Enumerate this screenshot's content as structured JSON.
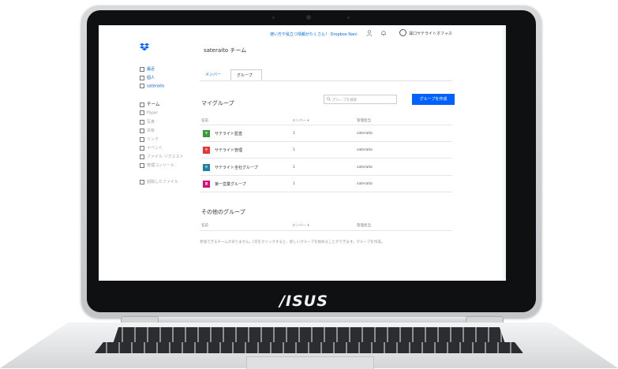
{
  "device": {
    "brand": "/ISUS"
  },
  "app": {
    "page_title": "sateraito チーム",
    "topbar_link": "使い方や役立つ情報がたくさん！ Dropbox Nani",
    "user_name": "凜口サテライトオフィス",
    "caret": "⌄"
  },
  "sidebar": {
    "items": [
      {
        "label": "最近",
        "style": "blue"
      },
      {
        "label": "個人",
        "style": "blue"
      },
      {
        "label": "sateraito",
        "style": "blue"
      },
      {
        "label": "チーム",
        "style": "team"
      },
      {
        "label": "Paper",
        "style": "gray"
      },
      {
        "label": "写真",
        "style": "gray"
      },
      {
        "label": "共有",
        "style": "gray"
      },
      {
        "label": "リンク",
        "style": "gray"
      },
      {
        "label": "イベント",
        "style": "gray"
      },
      {
        "label": "ファイル リクエスト",
        "style": "gray"
      },
      {
        "label": "管理コンソール",
        "style": "gray"
      },
      {
        "label": "削除したファイル",
        "style": "gray"
      }
    ]
  },
  "tabs": [
    {
      "label": "メンバー",
      "active": false
    },
    {
      "label": "グループ",
      "active": true
    }
  ],
  "my_groups": {
    "title": "マイグループ",
    "search_placeholder": "グループを検索",
    "create_button": "グループを作成",
    "columns": [
      "名前",
      "メンバー ▾",
      "管理担当"
    ],
    "rows": [
      {
        "badge": "サ",
        "color": "#3c9a3a",
        "name": "サテライト監査",
        "members": "1",
        "admin": "sateraito"
      },
      {
        "badge": "サ",
        "color": "#e2363b",
        "name": "サテライト管理",
        "members": "1",
        "admin": "sateraito"
      },
      {
        "badge": "サ",
        "color": "#1f7fa8",
        "name": "サテライト全社グループ",
        "members": "1",
        "admin": "sateraito"
      },
      {
        "badge": "第",
        "color": "#d4127d",
        "name": "第一営業グループ",
        "members": "1",
        "admin": "sateraito"
      }
    ]
  },
  "other_groups": {
    "title": "その他のグループ",
    "columns": [
      "名前",
      "メンバー ▾",
      "管理担当"
    ],
    "note": "参加できるチームがありません。[次をクリックすると、新しいグループを始めることができます。グループを作成。"
  },
  "colors": {
    "accent": "#0061fe",
    "link": "#0070e0",
    "dropbox": "#0061fe"
  }
}
